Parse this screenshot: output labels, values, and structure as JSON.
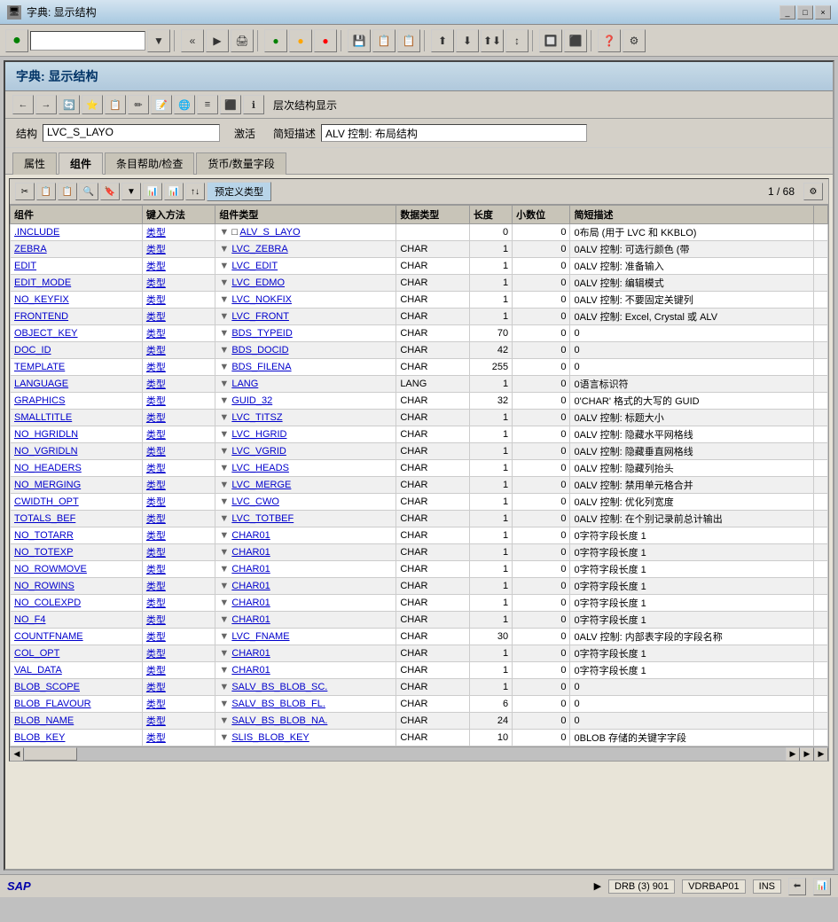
{
  "window": {
    "title": "字典: 显示结构",
    "buttons": [
      "_",
      "□",
      "×"
    ]
  },
  "toolbar": {
    "dropdown_value": "",
    "buttons": [
      "◀◀",
      "▶",
      "✗",
      "📋",
      "🔄",
      "🔴",
      "🟠",
      "🔶",
      "📄",
      "📊",
      "📊",
      "⬆",
      "⬇",
      "⬆⬇",
      "📤",
      "📄",
      "📄",
      "🔲",
      "⬛",
      "❓",
      "📊"
    ]
  },
  "panel": {
    "title": "字典:  显示结构",
    "toolbar_buttons": [
      "←",
      "→",
      "🔄",
      "⭐",
      "📋",
      "✏️",
      "📝",
      "🌐",
      "≡",
      "⬛",
      "ℹ"
    ],
    "layer_text": "层次结构显示",
    "structure_label": "结构",
    "structure_value": "LVC_S_LAYO",
    "activate_label": "激活",
    "desc_label": "简短描述",
    "desc_value": "ALV 控制: 布局结构",
    "tabs": [
      "属性",
      "组件",
      "条目帮助/检查",
      "货币/数量字段"
    ],
    "active_tab": "组件"
  },
  "table": {
    "page_info": "1 / 68",
    "predef_label": "预定义类型",
    "toolbar_buttons": [
      "✂",
      "📋",
      "📋",
      "🔍",
      "🔖",
      "▼",
      "📊",
      "📊",
      "↑↓"
    ],
    "columns": [
      "组件",
      "键入方法",
      "组件类型",
      "数据类型",
      "长度",
      "小数位",
      "简短描述"
    ],
    "rows": [
      {
        "component": ".INCLUDE",
        "key_method": "类型",
        "comp_type": "ALV_S_LAYO",
        "data_type": "",
        "length": 0,
        "decimals": 0,
        "desc": "0布局 (用于 LVC 和 KKBLO)",
        "has_arrow": true,
        "icon": "□"
      },
      {
        "component": "ZEBRA",
        "key_method": "类型",
        "comp_type": "LVC_ZEBRA",
        "data_type": "CHAR",
        "length": 1,
        "decimals": 0,
        "desc": "0ALV 控制: 可选行颜色 (带",
        "has_arrow": true
      },
      {
        "component": "EDIT",
        "key_method": "类型",
        "comp_type": "LVC_EDIT",
        "data_type": "CHAR",
        "length": 1,
        "decimals": 0,
        "desc": "0ALV 控制: 准备输入",
        "has_arrow": true
      },
      {
        "component": "EDIT_MODE",
        "key_method": "类型",
        "comp_type": "LVC_EDMO",
        "data_type": "CHAR",
        "length": 1,
        "decimals": 0,
        "desc": "0ALV 控制: 编辑模式",
        "has_arrow": true
      },
      {
        "component": "NO_KEYFIX",
        "key_method": "类型",
        "comp_type": "LVC_NOKFIX",
        "data_type": "CHAR",
        "length": 1,
        "decimals": 0,
        "desc": "0ALV 控制: 不要固定关键列",
        "has_arrow": true
      },
      {
        "component": "FRONTEND",
        "key_method": "类型",
        "comp_type": "LVC_FRONT",
        "data_type": "CHAR",
        "length": 1,
        "decimals": 0,
        "desc": "0ALV 控制: Excel, Crystal 或 ALV",
        "has_arrow": true
      },
      {
        "component": "OBJECT_KEY",
        "key_method": "类型",
        "comp_type": "BDS_TYPEID",
        "data_type": "CHAR",
        "length": 70,
        "decimals": 0,
        "desc": "0",
        "has_arrow": true
      },
      {
        "component": "DOC_ID",
        "key_method": "类型",
        "comp_type": "BDS_DOCID",
        "data_type": "CHAR",
        "length": 42,
        "decimals": 0,
        "desc": "0",
        "has_arrow": true
      },
      {
        "component": "TEMPLATE",
        "key_method": "类型",
        "comp_type": "BDS_FILENA",
        "data_type": "CHAR",
        "length": 255,
        "decimals": 0,
        "desc": "0",
        "has_arrow": true
      },
      {
        "component": "LANGUAGE",
        "key_method": "类型",
        "comp_type": "LANG",
        "data_type": "LANG",
        "length": 1,
        "decimals": 0,
        "desc": "0语言标识符",
        "has_arrow": true
      },
      {
        "component": "GRAPHICS",
        "key_method": "类型",
        "comp_type": "GUID_32",
        "data_type": "CHAR",
        "length": 32,
        "decimals": 0,
        "desc": "0'CHAR' 格式的大写的 GUID",
        "has_arrow": true
      },
      {
        "component": "SMALLTITLE",
        "key_method": "类型",
        "comp_type": "LVC_TITSZ",
        "data_type": "CHAR",
        "length": 1,
        "decimals": 0,
        "desc": "0ALV 控制: 标题大小",
        "has_arrow": true
      },
      {
        "component": "NO_HGRIDLN",
        "key_method": "类型",
        "comp_type": "LVC_HGRID",
        "data_type": "CHAR",
        "length": 1,
        "decimals": 0,
        "desc": "0ALV 控制: 隐藏水平网格线",
        "has_arrow": true
      },
      {
        "component": "NO_VGRIDLN",
        "key_method": "类型",
        "comp_type": "LVC_VGRID",
        "data_type": "CHAR",
        "length": 1,
        "decimals": 0,
        "desc": "0ALV 控制: 隐藏垂直网格线",
        "has_arrow": true
      },
      {
        "component": "NO_HEADERS",
        "key_method": "类型",
        "comp_type": "LVC_HEADS",
        "data_type": "CHAR",
        "length": 1,
        "decimals": 0,
        "desc": "0ALV 控制: 隐藏列抬头",
        "has_arrow": true
      },
      {
        "component": "NO_MERGING",
        "key_method": "类型",
        "comp_type": "LVC_MERGE",
        "data_type": "CHAR",
        "length": 1,
        "decimals": 0,
        "desc": "0ALV 控制: 禁用单元格合并",
        "has_arrow": true
      },
      {
        "component": "CWIDTH_OPT",
        "key_method": "类型",
        "comp_type": "LVC_CWO",
        "data_type": "CHAR",
        "length": 1,
        "decimals": 0,
        "desc": "0ALV 控制: 优化列宽度",
        "has_arrow": true
      },
      {
        "component": "TOTALS_BEF",
        "key_method": "类型",
        "comp_type": "LVC_TOTBEF",
        "data_type": "CHAR",
        "length": 1,
        "decimals": 0,
        "desc": "0ALV 控制: 在个别记录前总计输出",
        "has_arrow": true
      },
      {
        "component": "NO_TOTARR",
        "key_method": "类型",
        "comp_type": "CHAR01",
        "data_type": "CHAR",
        "length": 1,
        "decimals": 0,
        "desc": "0字符字段长度 1",
        "has_arrow": true
      },
      {
        "component": "NO_TOTEXP",
        "key_method": "类型",
        "comp_type": "CHAR01",
        "data_type": "CHAR",
        "length": 1,
        "decimals": 0,
        "desc": "0字符字段长度 1",
        "has_arrow": true
      },
      {
        "component": "NO_ROWMOVE",
        "key_method": "类型",
        "comp_type": "CHAR01",
        "data_type": "CHAR",
        "length": 1,
        "decimals": 0,
        "desc": "0字符字段长度 1",
        "has_arrow": true
      },
      {
        "component": "NO_ROWINS",
        "key_method": "类型",
        "comp_type": "CHAR01",
        "data_type": "CHAR",
        "length": 1,
        "decimals": 0,
        "desc": "0字符字段长度 1",
        "has_arrow": true
      },
      {
        "component": "NO_COLEXPD",
        "key_method": "类型",
        "comp_type": "CHAR01",
        "data_type": "CHAR",
        "length": 1,
        "decimals": 0,
        "desc": "0字符字段长度 1",
        "has_arrow": true
      },
      {
        "component": "NO_F4",
        "key_method": "类型",
        "comp_type": "CHAR01",
        "data_type": "CHAR",
        "length": 1,
        "decimals": 0,
        "desc": "0字符字段长度 1",
        "has_arrow": true
      },
      {
        "component": "COUNTFNAME",
        "key_method": "类型",
        "comp_type": "LVC_FNAME",
        "data_type": "CHAR",
        "length": 30,
        "decimals": 0,
        "desc": "0ALV 控制: 内部表字段的字段名称",
        "has_arrow": true
      },
      {
        "component": "COL_OPT",
        "key_method": "类型",
        "comp_type": "CHAR01",
        "data_type": "CHAR",
        "length": 1,
        "decimals": 0,
        "desc": "0字符字段长度 1",
        "has_arrow": true
      },
      {
        "component": "VAL_DATA",
        "key_method": "类型",
        "comp_type": "CHAR01",
        "data_type": "CHAR",
        "length": 1,
        "decimals": 0,
        "desc": "0字符字段长度 1",
        "has_arrow": true
      },
      {
        "component": "BLOB_SCOPE",
        "key_method": "类型",
        "comp_type": "SALV_BS_BLOB_SC.",
        "data_type": "CHAR",
        "length": 1,
        "decimals": 0,
        "desc": "0",
        "has_arrow": true
      },
      {
        "component": "BLOB_FLAVOUR",
        "key_method": "类型",
        "comp_type": "SALV_BS_BLOB_FL.",
        "data_type": "CHAR",
        "length": 6,
        "decimals": 0,
        "desc": "0",
        "has_arrow": true
      },
      {
        "component": "BLOB_NAME",
        "key_method": "类型",
        "comp_type": "SALV_BS_BLOB_NA.",
        "data_type": "CHAR",
        "length": 24,
        "decimals": 0,
        "desc": "0",
        "has_arrow": true
      },
      {
        "component": "BLOB_KEY",
        "key_method": "类型",
        "comp_type": "SLIS_BLOB_KEY",
        "data_type": "CHAR",
        "length": 10,
        "decimals": 0,
        "desc": "0BLOB 存储的关键字字段",
        "has_arrow": true
      }
    ]
  },
  "status_bar": {
    "sap_logo": "SAP",
    "play_icon": "▶",
    "server": "DRB (3) 901",
    "client": "VDRBAP01",
    "mode": "INS",
    "icon1": "⬅",
    "icon2": "📊"
  }
}
